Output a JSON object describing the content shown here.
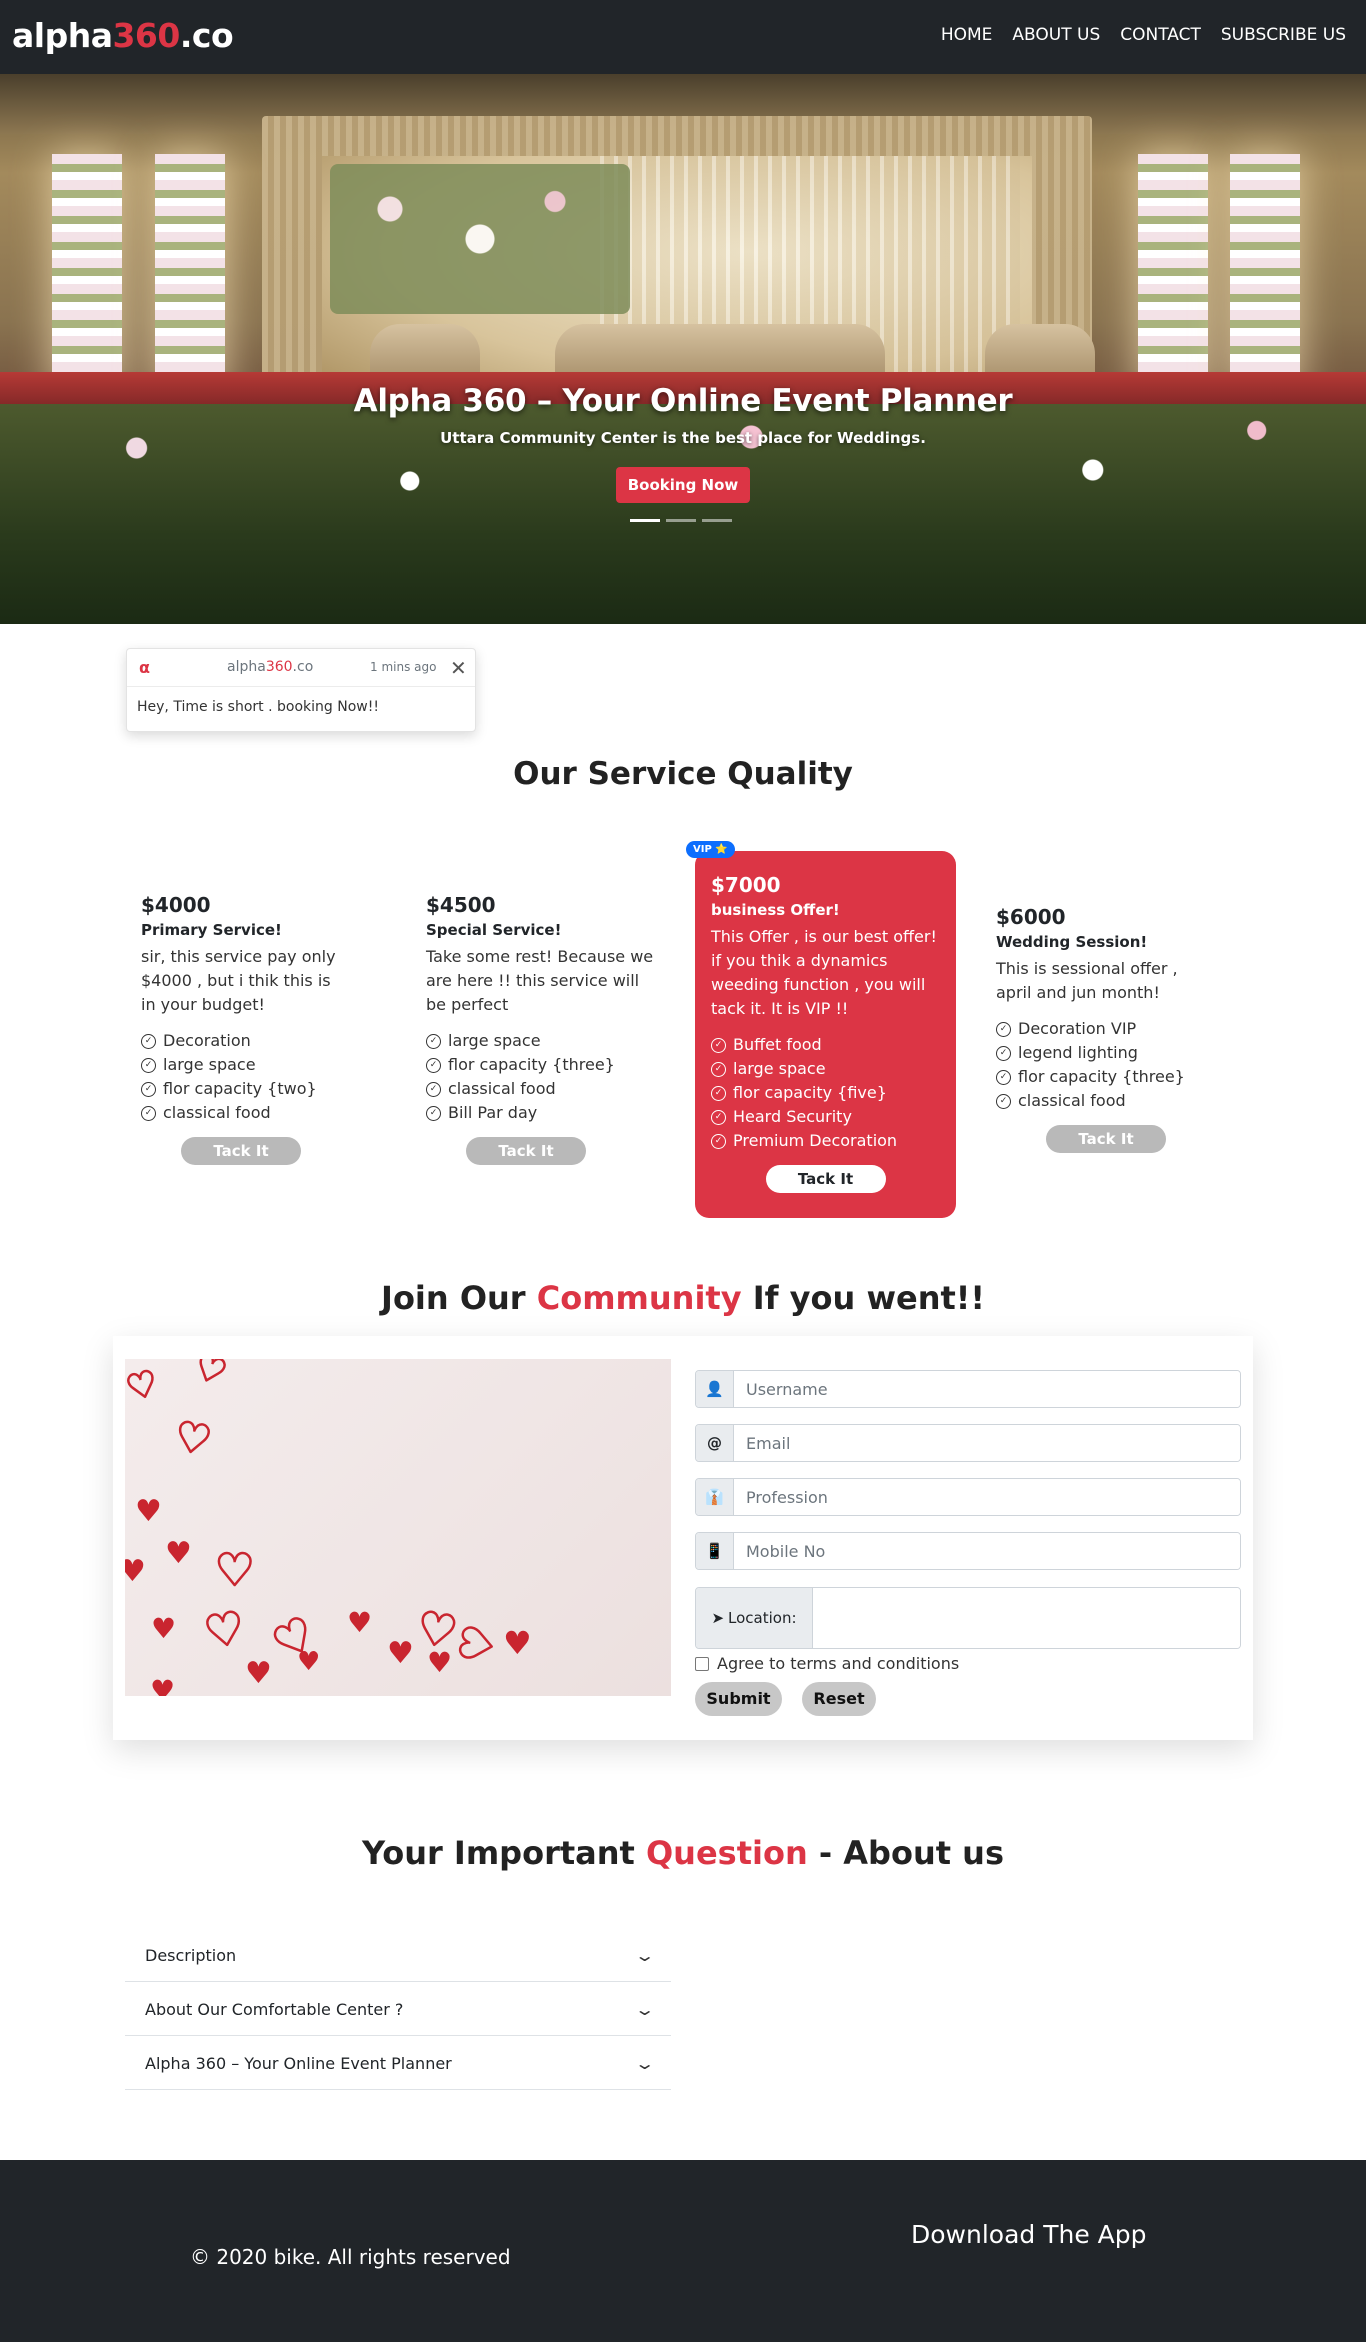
{
  "nav": {
    "brand_main": "alpha",
    "brand_accent": "360",
    "brand_tld": ".co",
    "links": [
      "HOME",
      "ABOUT US",
      "CONTACT",
      "SUBSCRIBE US"
    ]
  },
  "hero": {
    "title": "Alpha 360 – Your Online Event Planner",
    "subtitle": "Uttara Community Center is the best place for Weddings.",
    "button": "Booking Now",
    "slides": 3,
    "active_slide": 1
  },
  "toast": {
    "logo": "α",
    "brand_main": "alpha",
    "brand_accent": "360",
    "brand_tld": ".co",
    "time": "1 mins ago",
    "close": "✕",
    "message": "Hey, Time is short . booking Now!!"
  },
  "services": {
    "title": "Our Service Quality",
    "cards": [
      {
        "price": "$4000",
        "title": "Primary Service!",
        "description": "sir, this service pay only $4000 , but i thik this is in your budget!",
        "features": [
          "Decoration",
          "large space",
          " flor capacity {two}",
          " classical food"
        ],
        "button": "Tack It"
      },
      {
        "price": "$4500",
        "title": "Special Service!",
        "description": "Take some rest! Because we are here !! this service will be perfect",
        "features": [
          "large space",
          " flor capacity {three}",
          "classical food",
          " Bill Par day"
        ],
        "button": "Tack It"
      },
      {
        "badge": "VIP ⭐",
        "price": "$7000",
        "title": "business Offer!",
        "description": "This Offer , is our best offer! if you thik a dynamics weeding function , you will tack it. It is VIP !!",
        "features": [
          "Buffet food",
          "large space",
          "flor capacity {five}",
          " Heard Security",
          "Premium Decoration"
        ],
        "button": "Tack It"
      },
      {
        "price": "$6000",
        "title": "Wedding Session!",
        "description": "This is sessional offer , april and jun month!",
        "features": [
          "Decoration VIP",
          "legend lighting",
          " flor capacity {three}",
          " classical food"
        ],
        "button": "Tack It"
      }
    ]
  },
  "community": {
    "title_before": "Join Our ",
    "title_accent": "Community",
    "title_after": " If you went!!",
    "fields": [
      {
        "icon": "user-icon",
        "glyph": "👤",
        "placeholder": "Username"
      },
      {
        "icon": "at-icon",
        "glyph": "@",
        "placeholder": "Email"
      },
      {
        "icon": "user-tie-icon",
        "glyph": "👔",
        "placeholder": "Profession"
      },
      {
        "icon": "mobile-icon",
        "glyph": "📱",
        "placeholder": "Mobile No"
      }
    ],
    "location_label": "Location:",
    "agree_label": "Agree to terms and conditions",
    "submit": "Submit",
    "reset": "Reset"
  },
  "faq": {
    "title_before": "Your Important ",
    "title_accent": "Question",
    "title_after": " - About us",
    "items": [
      "Description",
      "About Our Comfortable Center ?",
      "Alpha 360 – Your Online Event Planner"
    ]
  },
  "footer": {
    "copyright": "© 2020 bike. All rights reserved",
    "download": "Download The App"
  },
  "colors": {
    "accent": "#dc3545",
    "dark": "#212529",
    "badge": "#0d6efd"
  }
}
